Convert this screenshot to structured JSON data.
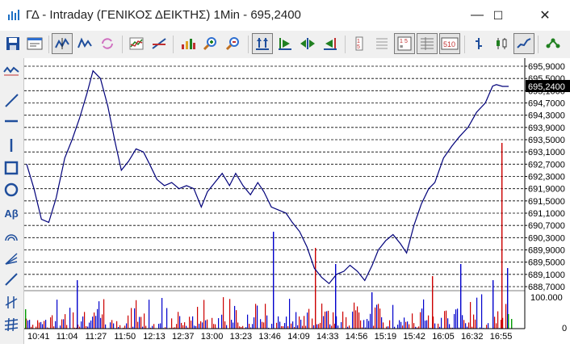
{
  "window": {
    "title": "ΓΔ - Intraday (ΓΕΝΙΚΟΣ ΔΕΙΚΤΗΣ) 1Min - 695,2400",
    "minimize_glyph": "—",
    "maximize_glyph": "☐",
    "close_glyph": "✕"
  },
  "toolbar": {
    "icons": [
      "save-icon",
      "properties-icon",
      "line-chart-icon",
      "candle-chart-icon",
      "refresh-icon",
      "indicator-icon",
      "trend-tool-icon",
      "volume-bars-icon",
      "zoom-in-icon",
      "zoom-out-icon",
      "fit-vertical-icon",
      "scroll-end-icon",
      "scroll-both-icon",
      "scroll-start-icon",
      "price-scale-icon",
      "grid-icon",
      "values-list-icon",
      "timeframe-icon",
      "bar-chart-icon",
      "candlestick-icon",
      "line-chart-active-icon",
      "network-icon"
    ]
  },
  "left_toolbar": {
    "text_tool_label": "Aβ",
    "icons": [
      "chart-type-icon",
      "diagonal-line-icon",
      "horizontal-line-icon",
      "vertical-line-icon",
      "rectangle-icon",
      "ellipse-icon",
      "text-icon",
      "arc-icon",
      "fan-icon",
      "channel-icon",
      "fibonacci-icon",
      "grid-lines-icon"
    ]
  },
  "chart_data": {
    "type": "line",
    "title": "",
    "current_value_label": "695,2400",
    "y_tick_labels": [
      "695,9000",
      "695,5000",
      "695,1000",
      "694,7000",
      "694,3000",
      "693,9000",
      "693,5000",
      "693,1000",
      "692,7000",
      "692,3000",
      "691,9000",
      "691,5000",
      "691,1000",
      "690,7000",
      "690,3000",
      "689,9000",
      "689,5000",
      "689,1000",
      "688,7000"
    ],
    "ylim": [
      688.5,
      696.0
    ],
    "x_tick_labels": [
      "10:41",
      "11:04",
      "11:27",
      "11:50",
      "12:13",
      "12:37",
      "13:00",
      "13:23",
      "13:46",
      "14:09",
      "14:33",
      "14:56",
      "15:19",
      "15:42",
      "16:05",
      "16:32",
      "16:55"
    ],
    "grid": true,
    "series": [
      {
        "color": "#00007a",
        "x": [
          "10:33",
          "10:39",
          "10:45",
          "10:51",
          "10:57",
          "11:04",
          "11:10",
          "11:16",
          "11:22",
          "11:27",
          "11:33",
          "11:39",
          "11:45",
          "11:50",
          "11:56",
          "12:02",
          "12:08",
          "12:13",
          "12:19",
          "12:25",
          "12:31",
          "12:37",
          "12:43",
          "12:49",
          "12:55",
          "13:00",
          "13:06",
          "13:12",
          "13:18",
          "13:23",
          "13:29",
          "13:35",
          "13:41",
          "13:46",
          "13:52",
          "13:58",
          "14:04",
          "14:09",
          "14:15",
          "14:21",
          "14:27",
          "14:33",
          "14:39",
          "14:45",
          "14:51",
          "14:56",
          "15:02",
          "15:08",
          "15:14",
          "15:19",
          "15:25",
          "15:31",
          "15:37",
          "15:42",
          "15:48",
          "15:54",
          "16:00",
          "16:05",
          "16:12",
          "16:19",
          "16:25",
          "16:32",
          "16:39",
          "16:46",
          "16:52",
          "16:55",
          "17:00",
          "17:05"
        ],
        "values": [
          692.7,
          691.9,
          690.9,
          690.8,
          691.6,
          692.9,
          693.5,
          694.2,
          695.0,
          695.75,
          695.5,
          694.6,
          693.4,
          692.5,
          692.8,
          693.2,
          693.1,
          692.7,
          692.2,
          692.0,
          692.1,
          691.9,
          692.0,
          691.9,
          691.3,
          691.8,
          692.1,
          692.4,
          692.0,
          692.4,
          692.0,
          691.7,
          692.1,
          691.8,
          691.3,
          691.2,
          691.1,
          690.8,
          690.5,
          690.0,
          689.3,
          689.0,
          688.8,
          689.1,
          689.2,
          689.4,
          689.2,
          688.9,
          689.4,
          689.9,
          690.2,
          690.4,
          690.1,
          689.8,
          690.7,
          691.4,
          691.9,
          692.1,
          692.9,
          693.3,
          693.6,
          693.9,
          694.4,
          694.7,
          695.25,
          695.3,
          695.24,
          695.24
        ]
      }
    ],
    "volume": {
      "axis_labels": [
        "100.000",
        "0"
      ],
      "bar_colors": [
        "#cc0000",
        "#0000cc",
        "#009900"
      ]
    }
  }
}
